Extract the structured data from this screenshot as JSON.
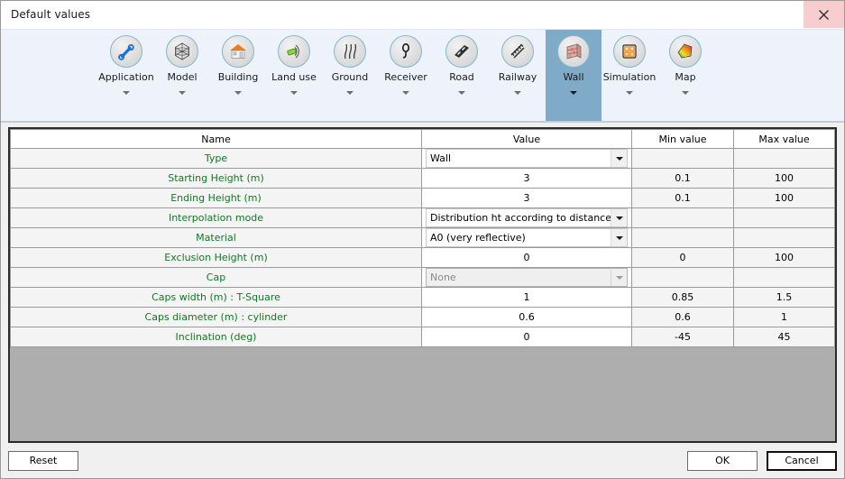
{
  "window": {
    "title": "Default values",
    "close_icon": "close-icon"
  },
  "ribbon": {
    "tabs": [
      {
        "label": "Application",
        "icon": "wrench-icon",
        "active": false
      },
      {
        "label": "Model",
        "icon": "mesh-sphere-icon",
        "active": false
      },
      {
        "label": "Building",
        "icon": "house-icon",
        "active": false
      },
      {
        "label": "Land use",
        "icon": "land-use-icon",
        "active": false
      },
      {
        "label": "Ground",
        "icon": "ground-contour-icon",
        "active": false
      },
      {
        "label": "Receiver",
        "icon": "microphone-icon",
        "active": false
      },
      {
        "label": "Road",
        "icon": "road-icon",
        "active": false
      },
      {
        "label": "Railway",
        "icon": "railway-icon",
        "active": false
      },
      {
        "label": "Wall",
        "icon": "brick-wall-icon",
        "active": true
      },
      {
        "label": "Simulation",
        "icon": "calculator-icon",
        "active": false
      },
      {
        "label": "Map",
        "icon": "color-map-icon",
        "active": false
      }
    ]
  },
  "grid": {
    "columns": [
      "Name",
      "Value",
      "Min value",
      "Max value"
    ],
    "rows": [
      {
        "name": "Type",
        "value": "Wall",
        "type": "combo",
        "min": "",
        "max": ""
      },
      {
        "name": "Starting Height (m)",
        "value": "3",
        "type": "number",
        "min": "0.1",
        "max": "100"
      },
      {
        "name": "Ending Height (m)",
        "value": "3",
        "type": "number",
        "min": "0.1",
        "max": "100"
      },
      {
        "name": "Interpolation mode",
        "value": "Distribution ht according to distances",
        "type": "combo",
        "min": "",
        "max": ""
      },
      {
        "name": "Material",
        "value": "A0 (very reflective)",
        "type": "combo",
        "min": "",
        "max": ""
      },
      {
        "name": "Exclusion Height (m)",
        "value": "0",
        "type": "number",
        "min": "0",
        "max": "100"
      },
      {
        "name": "Cap",
        "value": "None",
        "type": "combo-disabled",
        "min": "",
        "max": ""
      },
      {
        "name": "Caps width (m) : T-Square",
        "value": "1",
        "type": "number",
        "min": "0.85",
        "max": "1.5"
      },
      {
        "name": "Caps diameter (m) : cylinder",
        "value": "0.6",
        "type": "number",
        "min": "0.6",
        "max": "1"
      },
      {
        "name": "Inclination (deg)",
        "value": "0",
        "type": "number",
        "min": "-45",
        "max": "45"
      }
    ]
  },
  "footer": {
    "reset_label": "Reset",
    "ok_label": "OK",
    "cancel_label": "Cancel"
  },
  "colors": {
    "ribbon_bg": "#eef3fb",
    "active_tab": "#7fabc8",
    "name_text": "#0c7a22",
    "filler": "#aeaeae",
    "close_btn": "#f7cdd0"
  }
}
